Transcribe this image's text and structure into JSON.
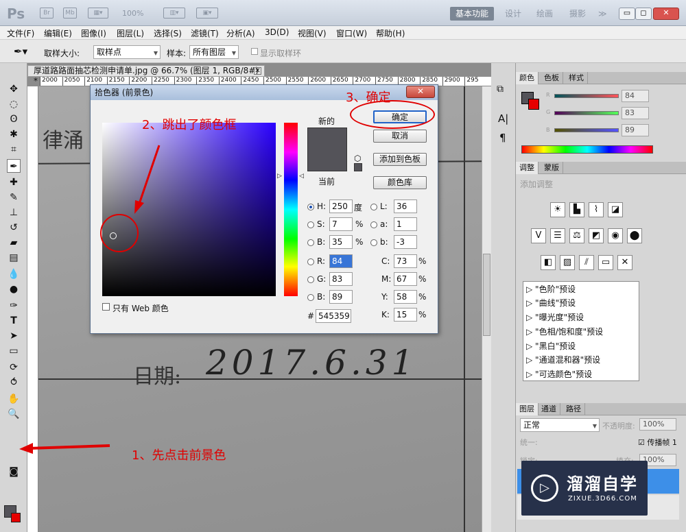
{
  "appbar": {
    "logo": "Ps",
    "br": "Br",
    "mb": "Mb",
    "zoom": "100%",
    "workspaces": [
      "基本功能",
      "设计",
      "绘画",
      "摄影"
    ],
    "more": "≫"
  },
  "menu": [
    "文件(F)",
    "编辑(E)",
    "图像(I)",
    "图层(L)",
    "选择(S)",
    "滤镜(T)",
    "分析(A)",
    "3D(D)",
    "视图(V)",
    "窗口(W)",
    "帮助(H)"
  ],
  "options": {
    "sample_size_label": "取样大小:",
    "sample_size_value": "取样点",
    "sample_label": "样本:",
    "sample_value": "所有图层",
    "show_ring": "显示取样环"
  },
  "document": {
    "tab_title": "厚道路路面抽芯检测申请单.jpg @ 66.7% (图层 1, RGB/8#) *",
    "ruler_ticks": [
      "2000",
      "2050",
      "2100",
      "2150",
      "2200",
      "2250",
      "2300",
      "2350",
      "2400",
      "2450",
      "2500",
      "2550",
      "2600",
      "2650",
      "2700",
      "2750",
      "2800",
      "2850",
      "2900",
      "295"
    ],
    "text_top": "律涌",
    "text_date_label": "日期:",
    "text_date_value": "2017.6.31"
  },
  "colorpicker": {
    "title": "拾色器 (前景色)",
    "new_label": "新的",
    "current_label": "当前",
    "ok": "确定",
    "cancel": "取消",
    "add_swatch": "添加到色板",
    "libraries": "颜色库",
    "only_web": "只有 Web 颜色",
    "swatch_color": "#545359",
    "fields": {
      "H": {
        "value": "250",
        "unit": "度"
      },
      "S": {
        "value": "7",
        "unit": "%"
      },
      "B": {
        "value": "35",
        "unit": "%"
      },
      "L": {
        "value": "36"
      },
      "a": {
        "value": "1"
      },
      "b": {
        "value": "-3"
      },
      "R": {
        "value": "84"
      },
      "G": {
        "value": "83"
      },
      "Bv": {
        "value": "89"
      },
      "C": {
        "value": "73",
        "unit": "%"
      },
      "M": {
        "value": "67",
        "unit": "%"
      },
      "Y": {
        "value": "58",
        "unit": "%"
      },
      "K": {
        "value": "15",
        "unit": "%"
      },
      "hex": "545359"
    }
  },
  "annotations": {
    "step1": "1、先点击前景色",
    "step2": "2、跳出了颜色框",
    "step3": "3、确定"
  },
  "panels": {
    "color_tabs": [
      "颜色",
      "色板",
      "样式"
    ],
    "color_values": [
      "84",
      "83",
      "89"
    ],
    "color_labels": [
      "R",
      "G",
      "B"
    ],
    "adjust_tabs": [
      "调整",
      "蒙版"
    ],
    "adjust_title": "添加调整",
    "presets": [
      "\"色阶\"预设",
      "\"曲线\"预设",
      "\"曝光度\"预设",
      "\"色相/饱和度\"预设",
      "\"黑白\"预设",
      "\"通道混和器\"预设",
      "\"可选颜色\"预设"
    ],
    "layer_tabs": [
      "图层",
      "通道",
      "路径"
    ],
    "blend_mode": "正常",
    "opacity_label": "不透明度:",
    "opacity_value": "100%",
    "unify_label": "统一:",
    "propagate": "传播帧 1",
    "lock_label": "锁定:",
    "fill_label": "填充:",
    "fill_value": "100%"
  },
  "watermark": {
    "name": "溜溜自学",
    "url": "ZIXUE.3D66.COM"
  }
}
